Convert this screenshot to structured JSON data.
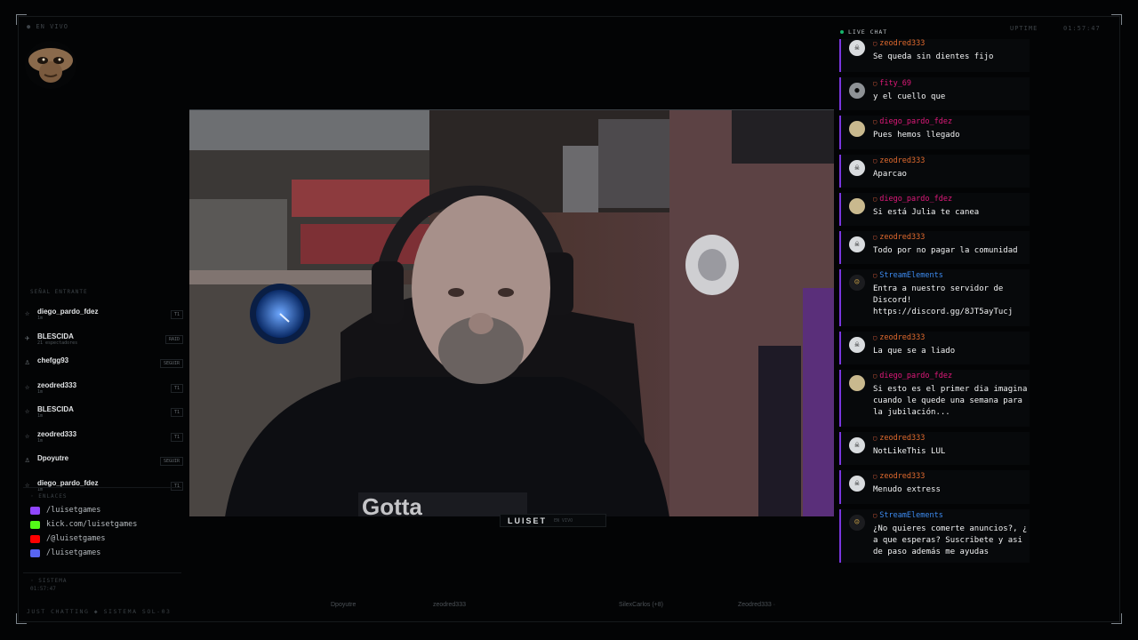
{
  "hud": {
    "live_tag": "● EN VIVO",
    "uptime_label": "UPTIME",
    "uptime_value": "01:57:47",
    "footer_left": "JUST CHATTING ◆ SISTEMA SOL-03"
  },
  "followers": {
    "title": "SEÑAL ENTRANTE",
    "items": [
      {
        "name": "diego_pardo_fdez",
        "sub": "1m",
        "badge": "T1",
        "icon": "star-icon"
      },
      {
        "name": "BLESCIDA",
        "sub": "21 espectadores",
        "badge": "RAID",
        "icon": "rocket-icon"
      },
      {
        "name": "chefgg93",
        "sub": "",
        "badge": "SEGUIR",
        "icon": "user-plus-icon"
      },
      {
        "name": "zeodred333",
        "sub": "1m",
        "badge": "T1",
        "icon": "star-icon"
      },
      {
        "name": "BLESCIDA",
        "sub": "1m",
        "badge": "T1",
        "icon": "star-icon"
      },
      {
        "name": "zeodred333",
        "sub": "1m",
        "badge": "T1",
        "icon": "star-icon"
      },
      {
        "name": "Dpoyutre",
        "sub": "",
        "badge": "SEGUIR",
        "icon": "user-plus-icon"
      },
      {
        "name": "diego_pardo_fdez",
        "sub": "1m",
        "badge": "T1",
        "icon": "star-icon"
      }
    ]
  },
  "links": {
    "title": "◦ ENLACES",
    "items": [
      {
        "text": "/luisetgames",
        "icon": "twitch-icon",
        "color": "#9146ff"
      },
      {
        "text": "kick.com/luisetgames",
        "icon": "kick-icon",
        "color": "#53fc18"
      },
      {
        "text": "/@luisetgames",
        "icon": "youtube-icon",
        "color": "#ff0000"
      },
      {
        "text": "/luisetgames",
        "icon": "discord-icon",
        "color": "#5865f2"
      }
    ]
  },
  "system": {
    "title": "◦ SISTEMA",
    "value": "01:57:47"
  },
  "video": {
    "streamer": "LUISET",
    "sub": "EN VIVO"
  },
  "ticker": [
    "Dpoyutre",
    "zeodred333",
    "SilexCarlos (+8)",
    "Zeodred333 · "
  ],
  "chat": {
    "header": "LIVE CHAT",
    "messages": [
      {
        "user": "zeodred333",
        "color": "#e06a2e",
        "text": "Se queda sin dientes fijo",
        "avatar": "skull-avatar"
      },
      {
        "user": "fity_69",
        "color": "#e0197a",
        "text": "y el cuello que",
        "avatar": "user-avatar"
      },
      {
        "user": "diego_pardo_fdez",
        "color": "#e0197a",
        "text": "Pues hemos llegado",
        "avatar": "dog-avatar"
      },
      {
        "user": "zeodred333",
        "color": "#e06a2e",
        "text": "Aparcao",
        "avatar": "skull-avatar"
      },
      {
        "user": "diego_pardo_fdez",
        "color": "#e0197a",
        "text": "Si está Julia te canea",
        "avatar": "dog-avatar"
      },
      {
        "user": "zeodred333",
        "color": "#e06a2e",
        "text": "Todo por no pagar la comunidad",
        "avatar": "skull-avatar"
      },
      {
        "user": "StreamElements",
        "color": "#3d8bf0",
        "text": "Entra a nuestro servidor de Discord! https://discord.gg/8JT5ayTucj",
        "avatar": "bot-avatar"
      },
      {
        "user": "zeodred333",
        "color": "#e06a2e",
        "text": "La que se a liado",
        "avatar": "skull-avatar"
      },
      {
        "user": "diego_pardo_fdez",
        "color": "#e0197a",
        "text": "Si esto es el primer dia imagina cuando le quede una semana para la jubilación...",
        "avatar": "dog-avatar"
      },
      {
        "user": "zeodred333",
        "color": "#e06a2e",
        "text": "NotLikeThis LUL",
        "avatar": "skull-avatar"
      },
      {
        "user": "zeodred333",
        "color": "#e06a2e",
        "text": "Menudo extress",
        "avatar": "skull-avatar"
      },
      {
        "user": "StreamElements",
        "color": "#3d8bf0",
        "text": "¿No quieres comerte anuncios?, ¿ a que esperas? Suscribete y asi de paso además me ayudas",
        "avatar": "bot-avatar"
      }
    ]
  }
}
